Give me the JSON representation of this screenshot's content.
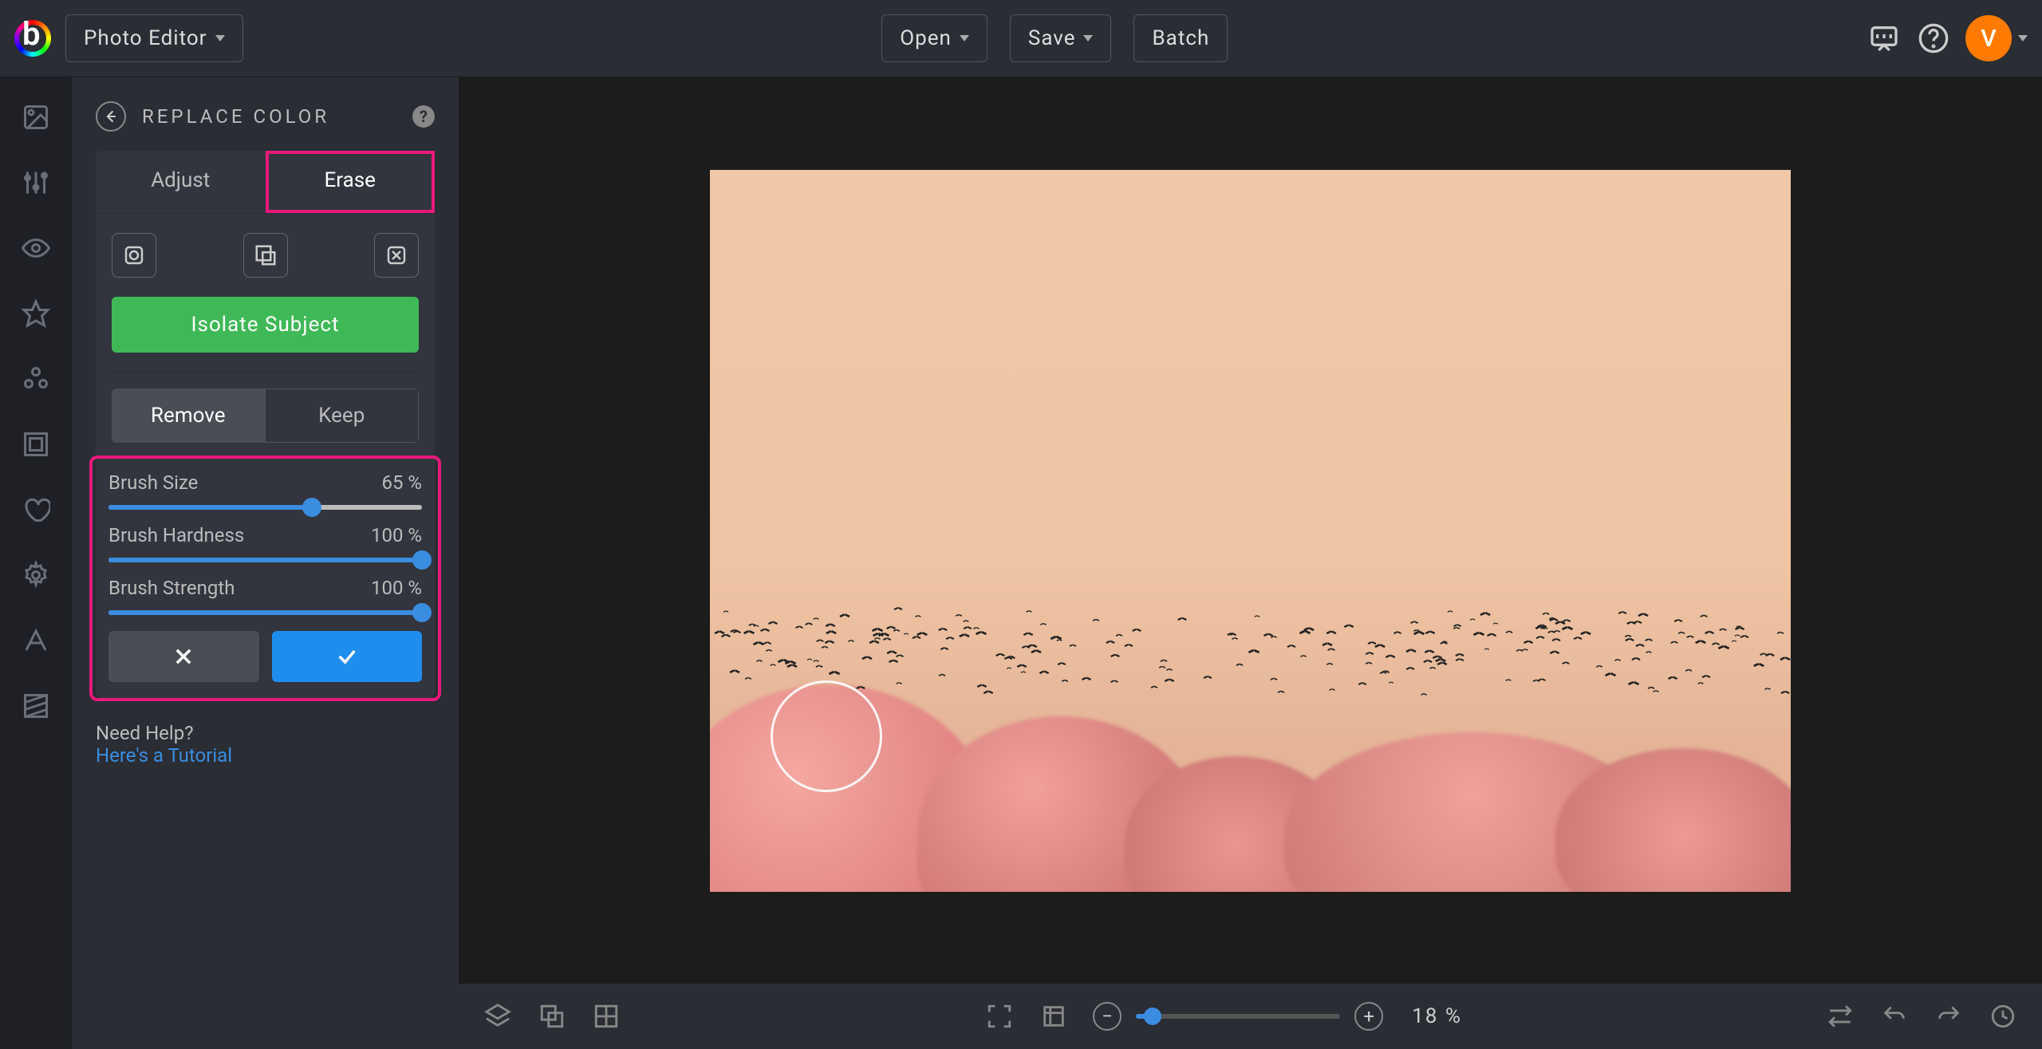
{
  "app": {
    "editor_label": "Photo Editor"
  },
  "topbar": {
    "open": "Open",
    "save": "Save",
    "batch": "Batch",
    "avatar_initial": "V"
  },
  "panel": {
    "title": "REPLACE COLOR",
    "tabs": {
      "adjust": "Adjust",
      "erase": "Erase",
      "active": "erase"
    },
    "isolate": "Isolate Subject",
    "segment": {
      "remove": "Remove",
      "keep": "Keep",
      "active": "remove"
    },
    "sliders": {
      "brush_size": {
        "label": "Brush Size",
        "value": 65,
        "unit": "%"
      },
      "brush_hardness": {
        "label": "Brush Hardness",
        "value": 100,
        "unit": "%"
      },
      "brush_strength": {
        "label": "Brush Strength",
        "value": 100,
        "unit": "%"
      }
    },
    "help": {
      "need": "Need Help?",
      "tutorial": "Here's a Tutorial"
    }
  },
  "bottombar": {
    "zoom": {
      "value": 18,
      "unit": "%"
    }
  }
}
